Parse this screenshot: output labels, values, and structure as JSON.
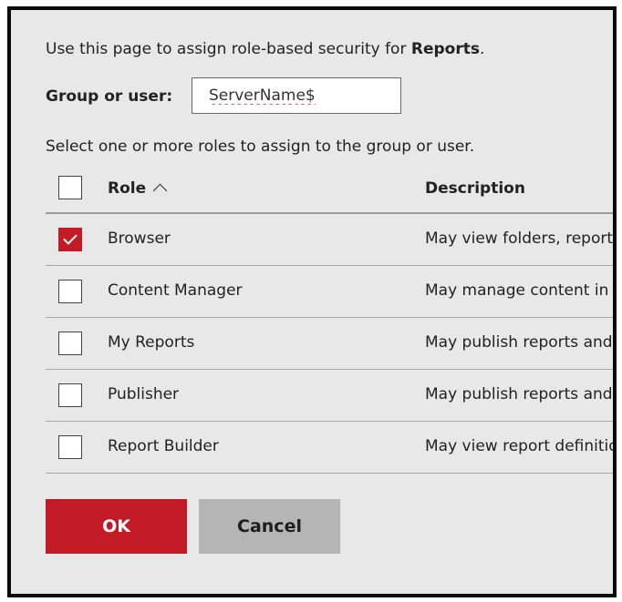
{
  "intro": {
    "text": "Use this page to assign role-based security for ",
    "item": "Reports",
    "suffix": "."
  },
  "group_user": {
    "label": "Group or user:",
    "value": "ServerName$"
  },
  "instruction": "Select one or more roles to assign to the group or user.",
  "table": {
    "headers": {
      "role": "Role",
      "description": "Description"
    },
    "sort": "ascending",
    "rows": [
      {
        "role": "Browser",
        "description": "May view folders, reports and subscribe to reports.",
        "checked": true
      },
      {
        "role": "Content Manager",
        "description": "May manage content in the Report Server.",
        "checked": false
      },
      {
        "role": "My Reports",
        "description": "May publish reports and linked reports.",
        "checked": false
      },
      {
        "role": "Publisher",
        "description": "May publish reports and linked reports.",
        "checked": false
      },
      {
        "role": "Report Builder",
        "description": "May view report definitions.",
        "checked": false
      }
    ]
  },
  "buttons": {
    "ok": "OK",
    "cancel": "Cancel"
  },
  "colors": {
    "accent": "#c21b25",
    "panel": "#e8e8e8",
    "cancel": "#b5b5b5"
  }
}
